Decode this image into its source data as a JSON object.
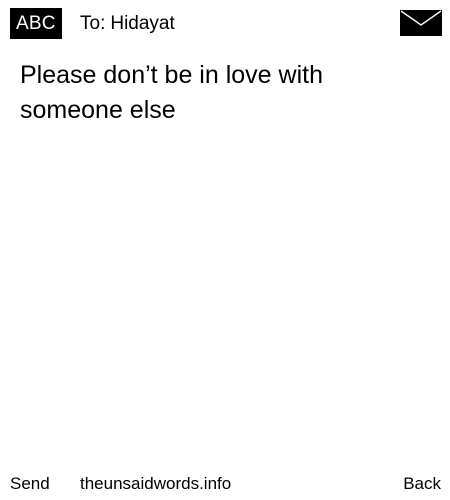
{
  "header": {
    "input_mode": "ABC",
    "recipient_prefix": "To:",
    "recipient_name": "Hidayat",
    "icon": "envelope-icon"
  },
  "message": {
    "body": "Please don’t be in love with\nsomeone else"
  },
  "footer": {
    "left_softkey": "Send",
    "site": "theunsaidwords.info",
    "right_softkey": "Back"
  },
  "colors": {
    "background": "#ffffff",
    "text": "#000000",
    "badge_background": "#000000",
    "badge_text": "#ffffff"
  }
}
